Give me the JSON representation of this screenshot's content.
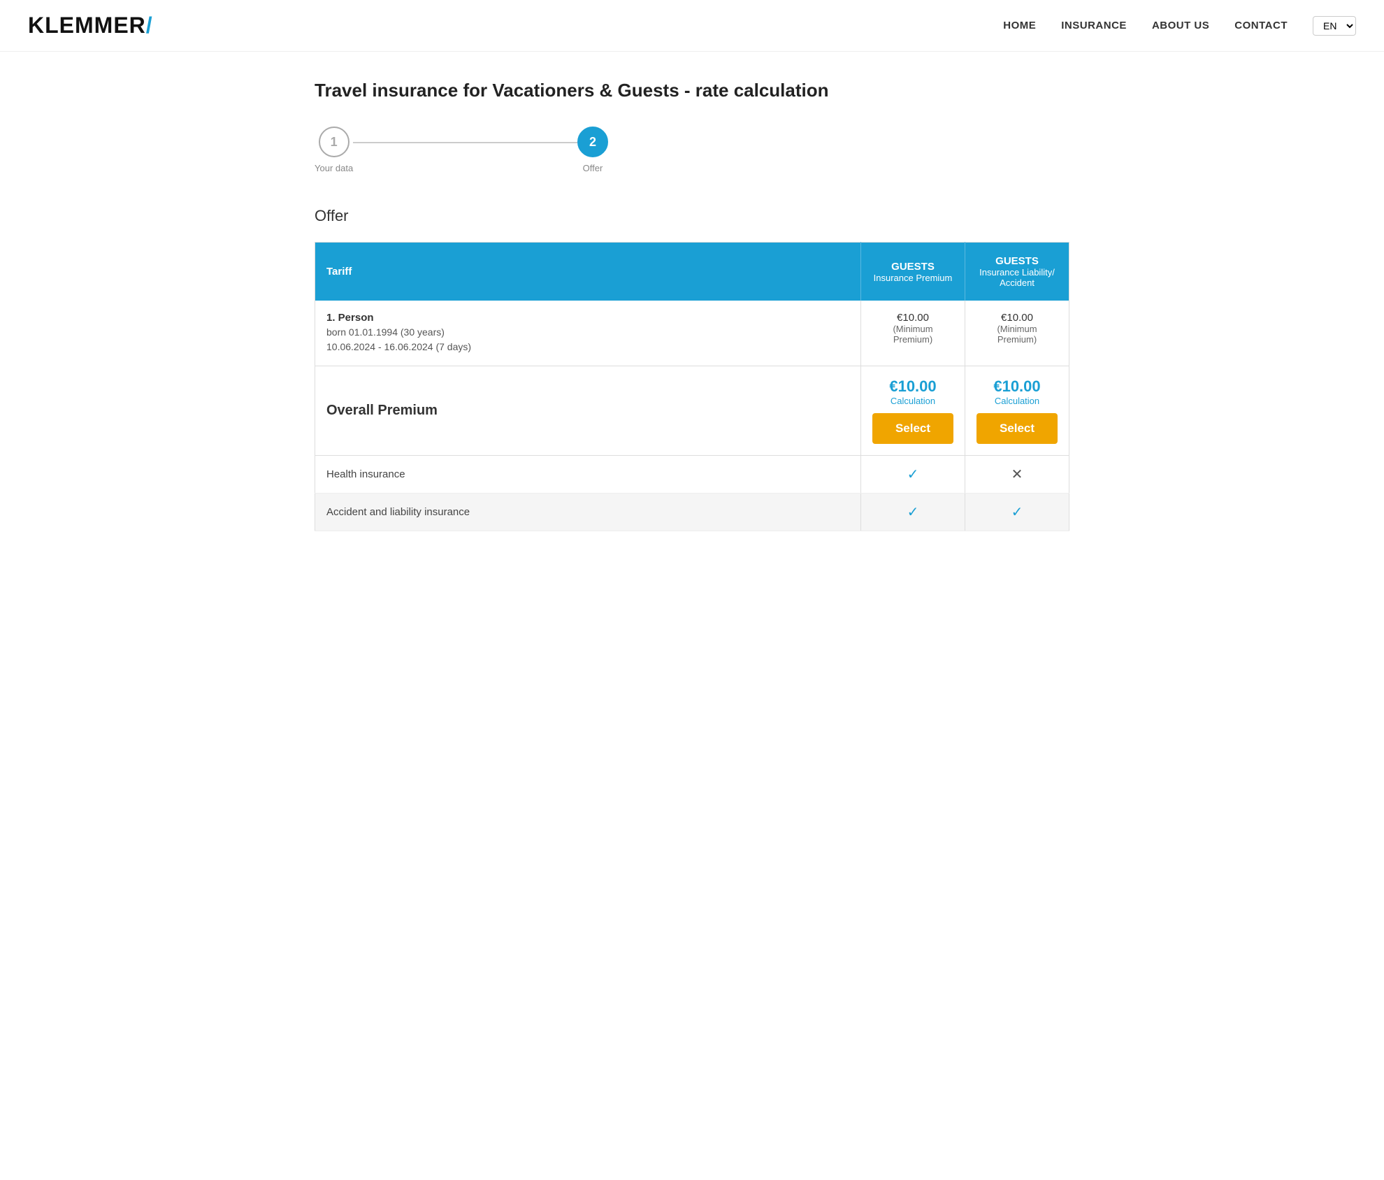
{
  "logo": {
    "text": "KLEMMER",
    "slash": "/"
  },
  "nav": {
    "home": "HOME",
    "insurance": "INSURANCE",
    "about": "ABOUT US",
    "contact": "CONTACT",
    "lang": "EN"
  },
  "page": {
    "title": "Travel insurance for Vacationers & Guests - rate calculation"
  },
  "stepper": {
    "step1": {
      "number": "1",
      "label": "Your data",
      "state": "inactive"
    },
    "step2": {
      "number": "2",
      "label": "Offer",
      "state": "active"
    }
  },
  "offer_section": {
    "title": "Offer"
  },
  "table": {
    "header": {
      "tariff": "Tariff",
      "col1_title": "GUESTS",
      "col1_sub1": "Insurance Premium",
      "col2_title": "GUESTS",
      "col2_sub1": "Insurance Liability/",
      "col2_sub2": "Accident"
    },
    "person": {
      "label": "1. Person",
      "born": "born 01.01.1994 (30 years)",
      "dates": "10.06.2024 - 16.06.2024 (7 days)",
      "col1_price": "€10.00",
      "col1_min": "(Minimum Premium)",
      "col2_price": "€10.00",
      "col2_min": "(Minimum Premium)"
    },
    "overall": {
      "label": "Overall Premium",
      "col1_price": "€10.00",
      "col1_calc": "Calculation",
      "col2_price": "€10.00",
      "col2_calc": "Calculation",
      "select1": "Select",
      "select2": "Select"
    },
    "features": [
      {
        "label": "Health insurance",
        "col1": "check",
        "col2": "cross",
        "shaded": false
      },
      {
        "label": "Accident and liability insurance",
        "col1": "check",
        "col2": "check",
        "shaded": true
      }
    ]
  }
}
